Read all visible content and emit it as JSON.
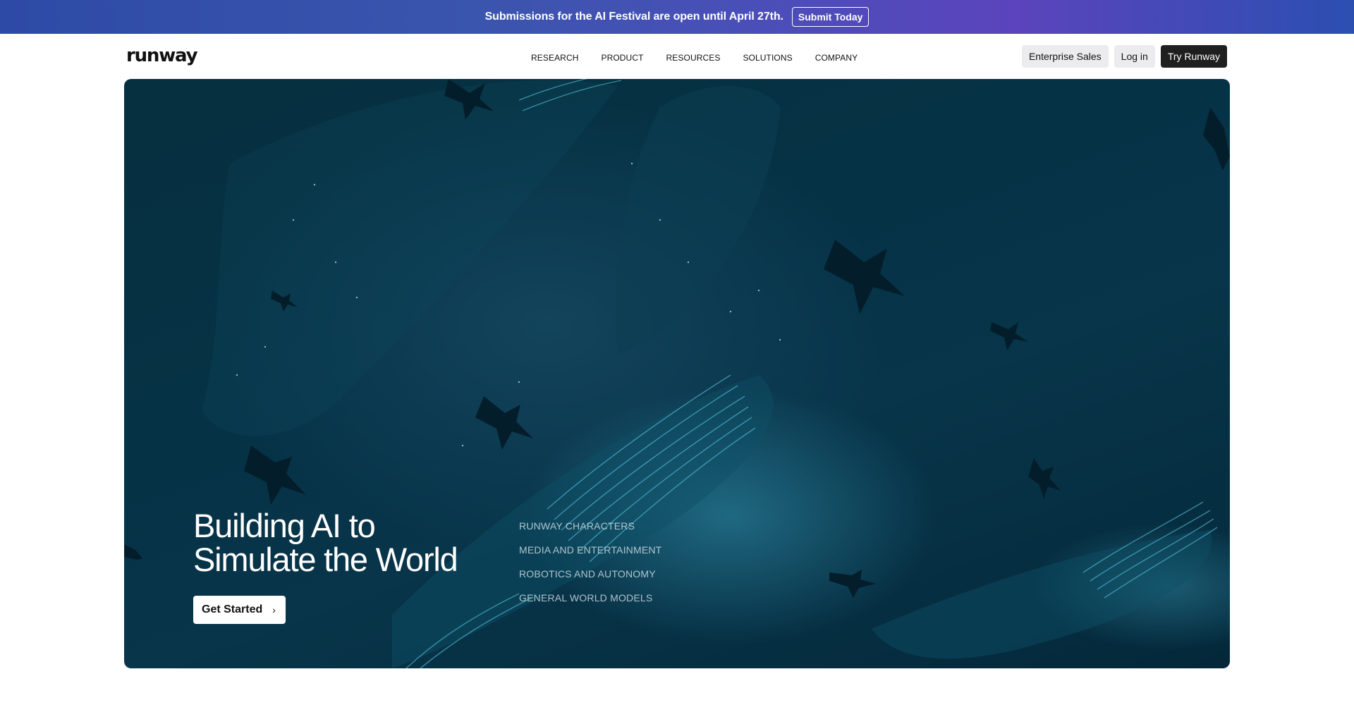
{
  "banner": {
    "text": "Submissions for the AI Festival are open until April 27th.",
    "button_label": "Submit Today"
  },
  "nav": {
    "logo": "runway",
    "menu": [
      "RESEARCH",
      "PRODUCT",
      "RESOURCES",
      "SOLUTIONS",
      "COMPANY"
    ],
    "actions": {
      "enterprise": "Enterprise Sales",
      "login": "Log in",
      "try": "Try Runway"
    }
  },
  "hero": {
    "headline_line1": "Building AI to",
    "headline_line2": "Simulate the World",
    "cta_label": "Get Started",
    "cta_icon": "chevron-right-icon",
    "topics": [
      "RUNWAY CHARACTERS",
      "MEDIA AND ENTERTAINMENT",
      "ROBOTICS AND AUTONOMY",
      "GENERAL WORLD MODELS"
    ]
  },
  "colors": {
    "banner_start": "#2d4aa6",
    "banner_mid": "#5b44bd",
    "hero_bg": "#06303f",
    "button_dark": "#1f1f1f",
    "button_light": "#ececee"
  }
}
